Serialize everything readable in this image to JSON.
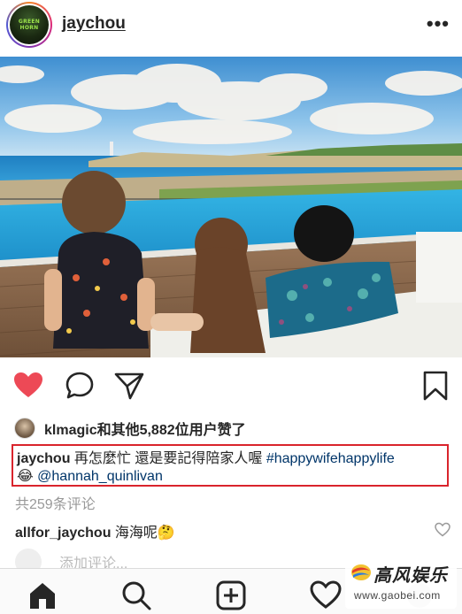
{
  "header": {
    "username": "jaychou",
    "avatar_text_line1": "GREEN",
    "avatar_text_line2": "HORN",
    "more_label": "•••"
  },
  "icons": {
    "like": "heart-filled-icon",
    "comment": "comment-bubble-icon",
    "share": "paper-plane-icon",
    "save": "bookmark-icon"
  },
  "colors": {
    "like_red": "#ed4956",
    "hashtag_blue": "#003569",
    "highlight_box": "#d9242c"
  },
  "likes": {
    "text": "klmagic和其他5,882位用户赞了"
  },
  "caption": {
    "user": "jaychou",
    "text": " 再怎麼忙 還是要記得陪家人喔 ",
    "hashtag": "#happywifehappylife",
    "emoji": "😂",
    "mention": "@hannah_quinlivan"
  },
  "comments": {
    "count_text": "共259条评论",
    "items": [
      {
        "user": "allfor_jaychou",
        "text": " 海海呢🤔"
      }
    ]
  },
  "add_comment": {
    "placeholder": "添加评论..."
  },
  "tabbar": {
    "items": [
      "home-icon",
      "search-icon",
      "new-post-icon",
      "activity-heart-icon",
      "profile-icon"
    ]
  },
  "watermark": {
    "title": "高风娱乐",
    "url": "www.gaobei.com"
  }
}
